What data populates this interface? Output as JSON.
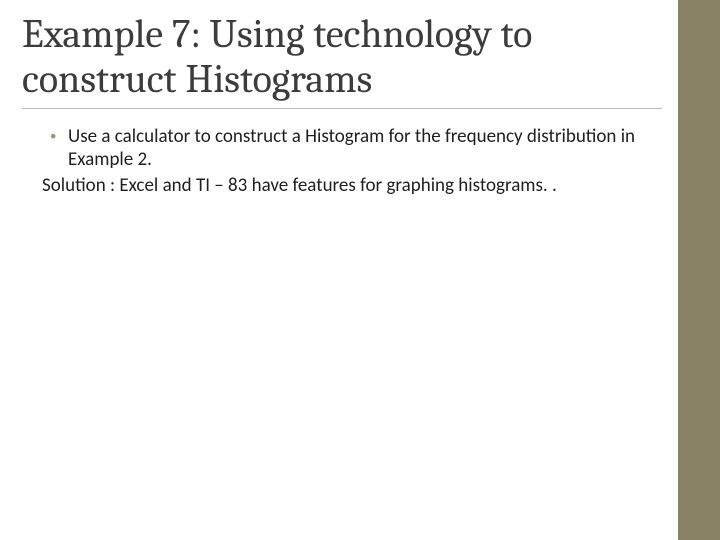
{
  "title": "Example 7: Using technology to construct Histograms",
  "bullet": "Use a calculator to construct a Histogram for the frequency distribution  in Example 2.",
  "solution": "Solution : Excel and TI – 83  have features  for graphing histograms. ."
}
